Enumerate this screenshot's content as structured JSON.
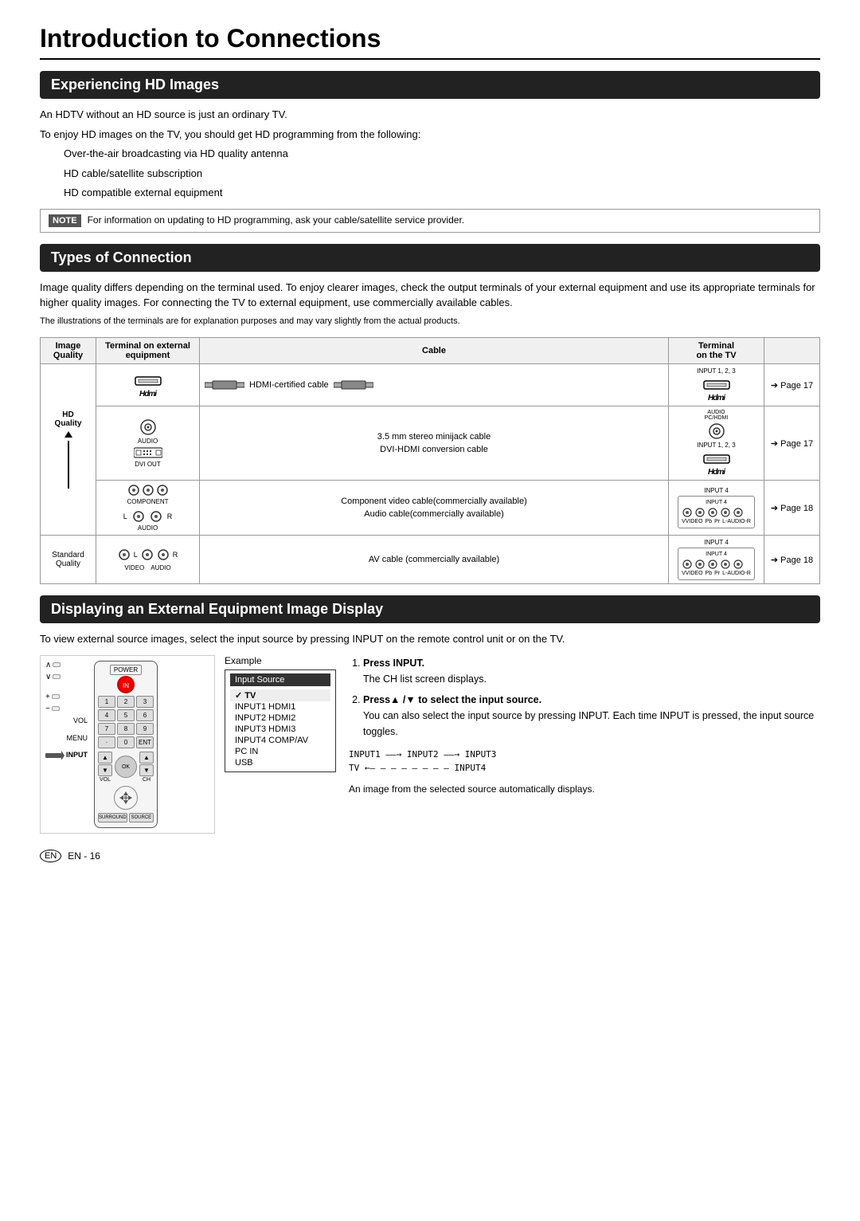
{
  "page": {
    "title": "Introduction to Connections",
    "footer": "EN - 16"
  },
  "section1": {
    "header": "Experiencing HD Images",
    "para1": "An HDTV without an HD source is just an ordinary TV.",
    "para2": "To enjoy HD images on the TV, you should get HD programming from the following:",
    "bullets": [
      "Over-the-air broadcasting via HD quality antenna",
      "HD cable/satellite subscription",
      "HD compatible external equipment"
    ],
    "note_label": "NOTE",
    "note_text": "For information on updating to HD programming, ask your cable/satellite service provider."
  },
  "section2": {
    "header": "Types of Connection",
    "para1": "Image quality differs depending on the terminal used. To enjoy clearer images, check the output terminals of your external equipment and use its appropriate terminals for higher quality images. For connecting the TV to external equipment, use commercially available cables.",
    "para2": "The illustrations of the terminals are for explanation purposes and may vary slightly from the actual products.",
    "table": {
      "col_headers": [
        "Image Quality",
        "Terminal on external equipment",
        "Cable",
        "Terminal on the TV"
      ],
      "rows": [
        {
          "quality": "HD Quality",
          "equipment_label": "HDMI",
          "cable_label": "HDMI-certified cable",
          "tv_label": "INPUT 1, 2, 3\nHDMI",
          "page_ref": "➔ Page  17"
        },
        {
          "quality": "",
          "equipment_label": "AUDIO / DVI OUT",
          "cable_label1": "3.5 mm stereo minijack cable",
          "cable_label2": "DVI-HDMI conversion cable",
          "tv_label": "INPUT 1, 2, 3\nHDMI",
          "page_ref": "➔ Page  17"
        },
        {
          "quality": "",
          "equipment_label": "COMPONENT / AUDIO",
          "cable_label1": "Component video cable(commercially available)",
          "cable_label2": "Audio cable(commercially available)",
          "tv_label": "INPUT 4",
          "page_ref": "➔ Page  18"
        },
        {
          "quality": "Standard Quality",
          "equipment_label": "VIDEO / AUDIO",
          "cable_label": "AV cable (commercially available)",
          "tv_label": "INPUT 4",
          "page_ref": "➔ Page  18"
        }
      ]
    }
  },
  "section3": {
    "header": "Displaying an External Equipment Image Display",
    "intro": "To view external source images, select the input source by pressing INPUT on the remote control unit or on the TV.",
    "example_label": "Example",
    "input_source_title": "Input Source",
    "menu_items": [
      {
        "label": "✓ TV",
        "active": true
      },
      {
        "label": "INPUT1  HDMI1",
        "active": false
      },
      {
        "label": "INPUT2  HDMI2",
        "active": false
      },
      {
        "label": "INPUT3  HDMI3",
        "active": false
      },
      {
        "label": "INPUT4  COMP/AV",
        "active": false
      },
      {
        "label": "PC IN",
        "active": false
      },
      {
        "label": "USB",
        "active": false
      }
    ],
    "steps": [
      {
        "num": 1,
        "text": "Press INPUT.",
        "sub": "The CH list screen displays."
      },
      {
        "num": 2,
        "text": "Press▲ /▼ to select the input source.",
        "sub": "You can also select the input source by pressing INPUT. Each time INPUT is pressed, the input source toggles."
      }
    ],
    "input_flow_line1": "INPUT1 ——→ INPUT2 ——→ INPUT3",
    "input_flow_line2": "TV ←— — — — — — — — INPUT4",
    "footer_note": "An image from the selected source automatically displays.",
    "remote_label": "INPUT",
    "remote_buttons": {
      "power": "POWER",
      "number_pad": [
        "1",
        "2",
        "3",
        "4",
        "5",
        "6",
        "7",
        "8",
        "9",
        "·",
        "0",
        "ENT"
      ],
      "controls": [
        "VOL",
        "CH",
        "MENU",
        "INPUT",
        "POWER"
      ]
    }
  }
}
